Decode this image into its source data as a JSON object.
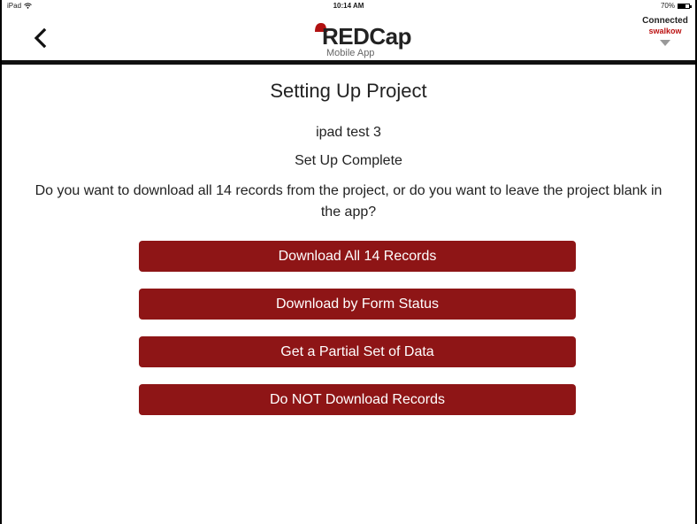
{
  "status_bar": {
    "device": "iPad",
    "time": "10:14 AM",
    "battery_percent": "70%",
    "battery_level": 0.7
  },
  "nav": {
    "back_icon": "chevron-left-icon",
    "logo_title": "REDCap",
    "logo_subtitle": "Mobile App",
    "connection_status": "Connected",
    "connection_label": "swalkow"
  },
  "main": {
    "title": "Setting Up Project",
    "project_name": "ipad test 3",
    "setup_status": "Set Up Complete",
    "prompt": "Do you want to download all 14 records from the project, or do you want to leave the project blank in the app?"
  },
  "actions": [
    {
      "label": "Download All 14 Records"
    },
    {
      "label": "Download by Form Status"
    },
    {
      "label": "Get a Partial Set of Data"
    },
    {
      "label": "Do NOT Download Records"
    }
  ],
  "colors": {
    "accent": "#8e1516",
    "connection_accent": "#bb1111"
  }
}
